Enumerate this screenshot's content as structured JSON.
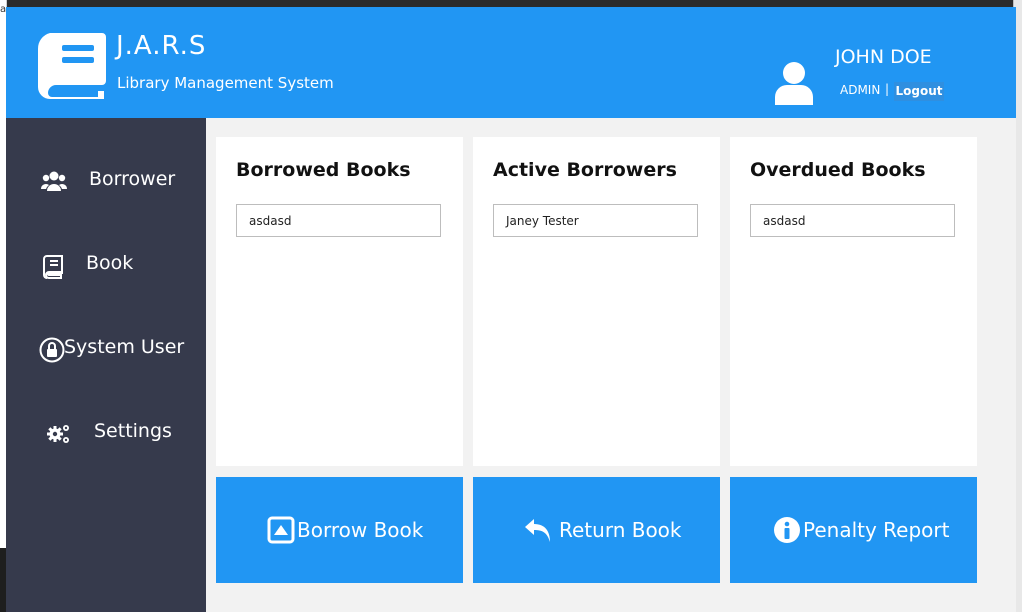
{
  "app": {
    "title": "J.A.R.S",
    "subtitle": "Library Management System"
  },
  "user": {
    "name": "JOHN DOE",
    "role": "ADMIN",
    "separator": "|",
    "logout_label": "Logout"
  },
  "sidebar": {
    "items": [
      {
        "label": "Borrower",
        "icon": "users-icon"
      },
      {
        "label": "Book",
        "icon": "book-icon"
      },
      {
        "label": "System User",
        "icon": "lock-icon"
      },
      {
        "label": "Settings",
        "icon": "gears-icon"
      }
    ]
  },
  "cards": [
    {
      "title": "Borrowed Books",
      "value": "asdasd"
    },
    {
      "title": "Active Borrowers",
      "value": "Janey Tester"
    },
    {
      "title": "Overdued Books",
      "value": "asdasd"
    }
  ],
  "actions": [
    {
      "label": "Borrow Book",
      "icon": "upload-box-icon"
    },
    {
      "label": "Return Book",
      "icon": "reply-arrow-icon"
    },
    {
      "label": "Penalty Report",
      "icon": "info-circle-icon"
    }
  ],
  "colors": {
    "header": "#2196f3",
    "sidebar": "#363a4c",
    "content_bg": "#f2f2f2",
    "action_button": "#2196f3"
  }
}
